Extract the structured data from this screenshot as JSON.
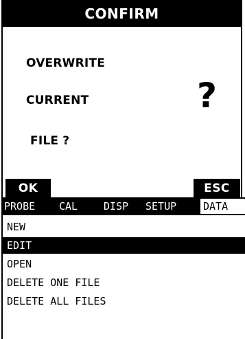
{
  "dialog": {
    "title": "CONFIRM",
    "message_lines": [
      "OVERWRITE",
      "CURRENT",
      "FILE ?"
    ],
    "icon": "question-mark-icon",
    "icon_glyph": "?",
    "ok_label": "OK",
    "esc_label": "ESC"
  },
  "tabs": [
    {
      "label": "PROBE",
      "active": false
    },
    {
      "label": "CAL",
      "active": false
    },
    {
      "label": "DISP",
      "active": false
    },
    {
      "label": "SETUP",
      "active": false
    },
    {
      "label": "DATA",
      "active": true
    }
  ],
  "menu": {
    "items": [
      {
        "label": "NEW",
        "selected": false
      },
      {
        "label": "EDIT",
        "selected": true
      },
      {
        "label": "OPEN",
        "selected": false
      },
      {
        "label": "DELETE ONE FILE",
        "selected": false
      },
      {
        "label": "DELETE ALL FILES",
        "selected": false
      }
    ]
  },
  "colors": {
    "foreground": "#000000",
    "background": "#ffffff"
  }
}
